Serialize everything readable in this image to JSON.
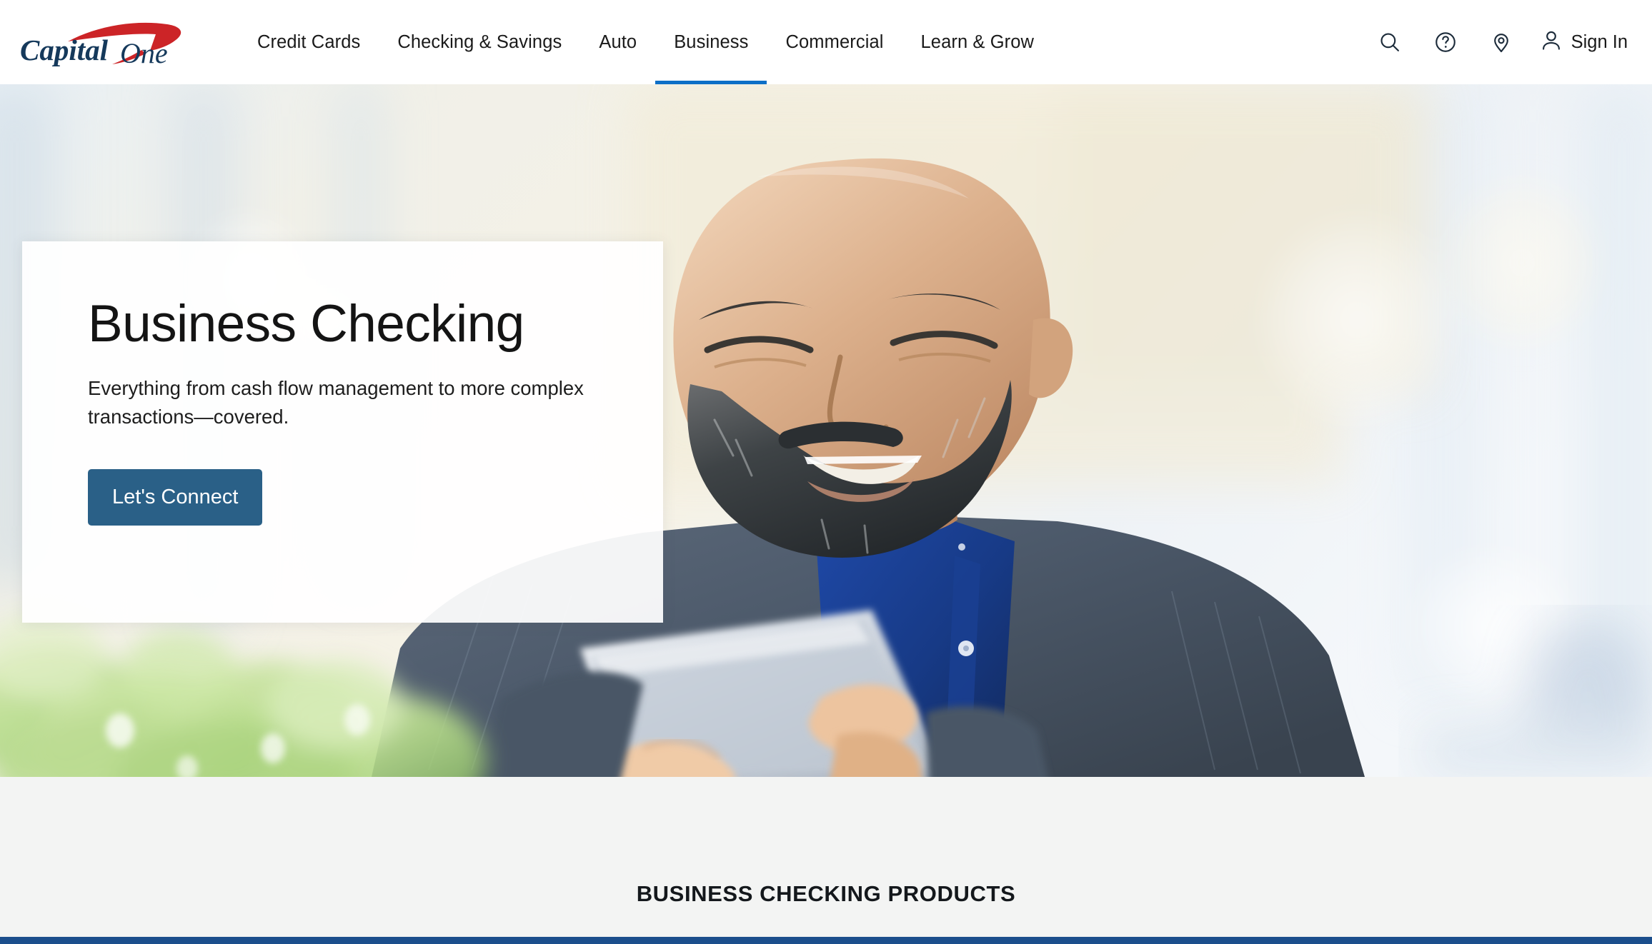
{
  "brand": {
    "logo_text_1": "Capital",
    "logo_text_2": "One",
    "navy": "#15395B",
    "red": "#CC2427",
    "accent_blue": "#0D6FC7",
    "button_blue": "#2A6087",
    "footer_blue": "#1B4E8C"
  },
  "nav": {
    "items": [
      {
        "label": "Credit Cards",
        "active": false
      },
      {
        "label": "Checking & Savings",
        "active": false
      },
      {
        "label": "Auto",
        "active": false
      },
      {
        "label": "Business",
        "active": true
      },
      {
        "label": "Commercial",
        "active": false
      },
      {
        "label": "Learn & Grow",
        "active": false
      }
    ],
    "utilities": [
      {
        "name": "search-icon",
        "label": "Search"
      },
      {
        "name": "help-icon",
        "label": "Help"
      },
      {
        "name": "location-pin-icon",
        "label": "Locations"
      }
    ],
    "sign_in_label": "Sign In",
    "sign_in_icon": "person-icon"
  },
  "hero": {
    "title": "Business Checking",
    "subtitle": "Everything from cash flow management to more complex transactions—covered.",
    "cta_label": "Let's Connect",
    "image_alt": "Smiling bearded man in a grey blazer and blue shirt using a tablet"
  },
  "products": {
    "heading": "BUSINESS CHECKING PRODUCTS"
  }
}
